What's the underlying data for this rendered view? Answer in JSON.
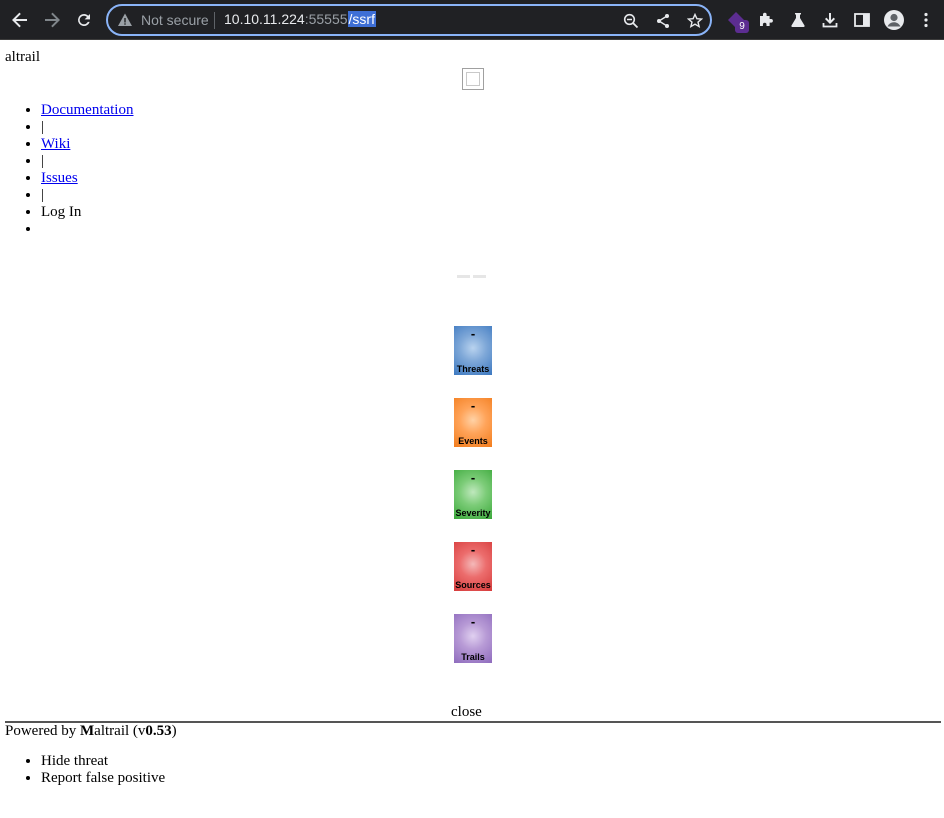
{
  "browser": {
    "security_label": "Not secure",
    "url_host": "10.10.11.224",
    "url_port": ":55555",
    "url_path": "/ssrf",
    "extension_badge": "9",
    "omnibox_border_color": "#8ab4f8"
  },
  "header": {
    "logo_alt": "altrail",
    "menu": [
      {
        "label": "Documentation"
      },
      {
        "label": "|"
      },
      {
        "label": "Wiki"
      },
      {
        "label": "|"
      },
      {
        "label": "Issues"
      },
      {
        "label": "|"
      },
      {
        "label": "Log In"
      },
      {
        "label": ""
      }
    ]
  },
  "tiles": [
    {
      "value": "-",
      "label": "Threats",
      "color": "#3c78c0"
    },
    {
      "value": "-",
      "label": "Events",
      "color": "#f27c1c"
    },
    {
      "value": "-",
      "label": "Severity",
      "color": "#3aa83a"
    },
    {
      "value": "-",
      "label": "Sources",
      "color": "#d63b3b"
    },
    {
      "value": "-",
      "label": "Trails",
      "color": "#8e6bbd"
    }
  ],
  "footer": {
    "close_alt": "close",
    "powered_prefix": "Powered by ",
    "brand_initial": "M",
    "brand_rest": "altrail",
    "version_open": " (v",
    "version": "0.53",
    "version_close": ")"
  },
  "context_menu": [
    {
      "label": "Hide threat"
    },
    {
      "label": "Report false positive"
    }
  ]
}
